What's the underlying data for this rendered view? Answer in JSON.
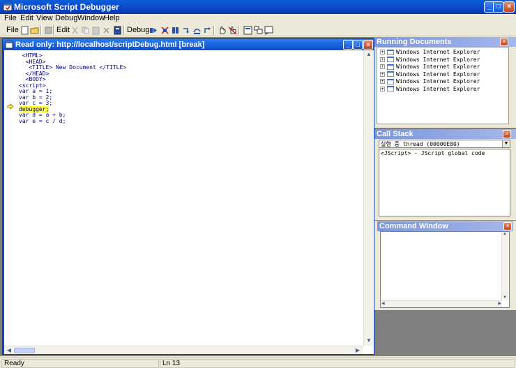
{
  "app": {
    "title": "Microsoft Script Debugger"
  },
  "menu": [
    "File",
    "Edit",
    "View",
    "Debug",
    "Window",
    "Help"
  ],
  "toolbar": {
    "file_label": "File",
    "edit_label": "Edit",
    "debug_label": "Debug"
  },
  "editor": {
    "title": "Read only: http://localhost/scriptDebug.html [break]",
    "lines": [
      " <HTML>",
      "  <HEAD>",
      "   <TITLE> New Document </TITLE>",
      "  </HEAD>",
      "  <BODY>",
      "<script>",
      "var a = 1;",
      "var b = 2;",
      "var c = 3;",
      "debugger;",
      "var d = a + b;",
      "var e = c / d;"
    ],
    "current_line": "debugger;"
  },
  "running_documents": {
    "title": "Running Documents",
    "items": [
      "Windows Internet Explorer",
      "Windows Internet Explorer",
      "Windows Internet Explorer",
      "Windows Internet Explorer",
      "Windows Internet Explorer",
      "Windows Internet Explorer"
    ]
  },
  "call_stack": {
    "title": "Call Stack",
    "thread": "실행 중 thread  (00000E80)",
    "entries": [
      "<JScript> - JScript global code"
    ]
  },
  "command_window": {
    "title": "Command Window"
  },
  "status": {
    "ready": "Ready",
    "line": "Ln 13"
  }
}
